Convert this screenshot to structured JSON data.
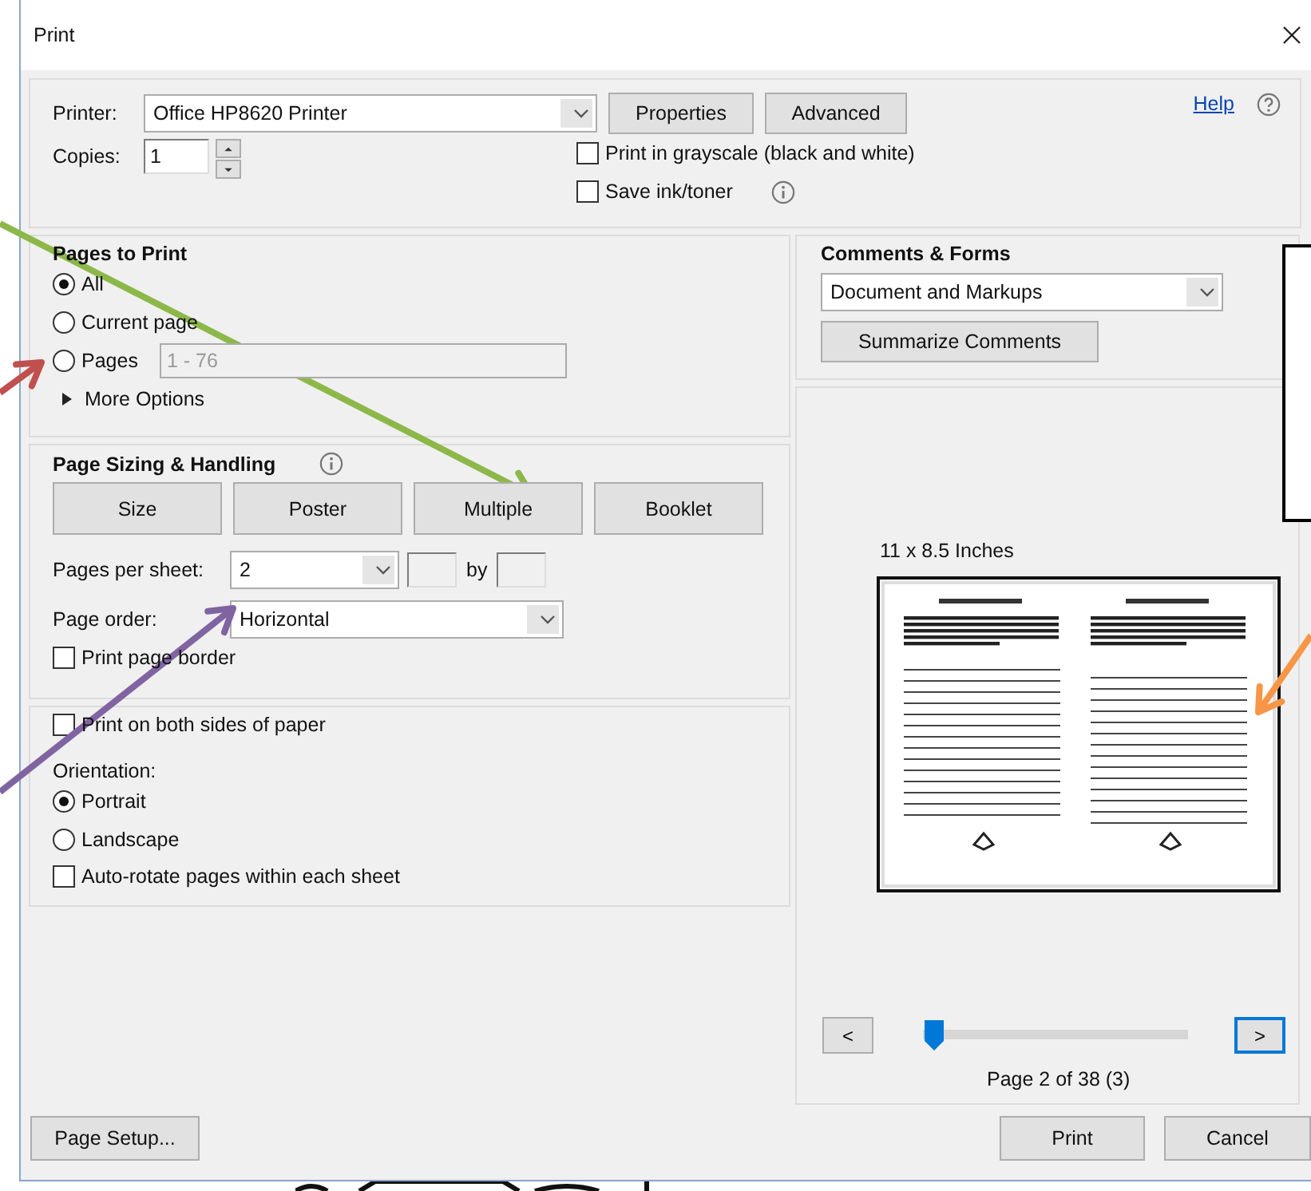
{
  "window": {
    "title": "Print"
  },
  "printer": {
    "label": "Printer:",
    "value": "Office HP8620 Printer"
  },
  "top_buttons": [
    "Properties",
    "Advanced"
  ],
  "help": "Help",
  "copies": {
    "label": "Copies:",
    "value": "1"
  },
  "print_options": [
    {
      "label": "Print in grayscale (black and white)",
      "checked": false,
      "info": false
    },
    {
      "label": "Save ink/toner",
      "checked": false,
      "info": true
    }
  ],
  "pages_to_print": {
    "title": "Pages to Print",
    "choices": [
      {
        "label": "All",
        "selected": true
      },
      {
        "label": "Current page",
        "selected": false
      },
      {
        "label": "Pages",
        "selected": false
      }
    ],
    "pages_range": "1 - 76",
    "more_options": "More Options",
    "more_expanded": false
  },
  "page_sizing": {
    "title": "Page Sizing & Handling",
    "modes": [
      "Size",
      "Poster",
      "Multiple",
      "Booklet"
    ],
    "pages_per_sheet": {
      "label": "Pages per sheet:",
      "value": "2",
      "by": "by"
    },
    "page_order": {
      "label": "Page order:",
      "value": "Horizontal"
    },
    "print_page_border": {
      "label": "Print page border",
      "checked": false
    }
  },
  "duplex": {
    "both_sides": {
      "label": "Print on both sides of paper",
      "checked": false
    },
    "orientation_label": "Orientation:",
    "orientations": [
      {
        "label": "Portrait",
        "selected": true
      },
      {
        "label": "Landscape",
        "selected": false
      }
    ],
    "auto_rotate": {
      "label": "Auto-rotate pages within each sheet",
      "checked": false
    }
  },
  "comments_forms": {
    "title": "Comments & Forms",
    "value": "Document and Markups",
    "button": "Summarize Comments"
  },
  "preview": {
    "paper_size": "11 x 8.5 Inches",
    "prev": "<",
    "next": ">",
    "level": 0.04,
    "page_info": "Page 2 of 38 (3)"
  },
  "footer": {
    "page_setup": "Page Setup...",
    "print": "Print",
    "cancel": "Cancel"
  },
  "annotation_arrows": [
    {
      "color": "#8cb84a"
    },
    {
      "color": "#c0504d"
    },
    {
      "color": "#8064a2"
    },
    {
      "color": "#f79646"
    }
  ]
}
